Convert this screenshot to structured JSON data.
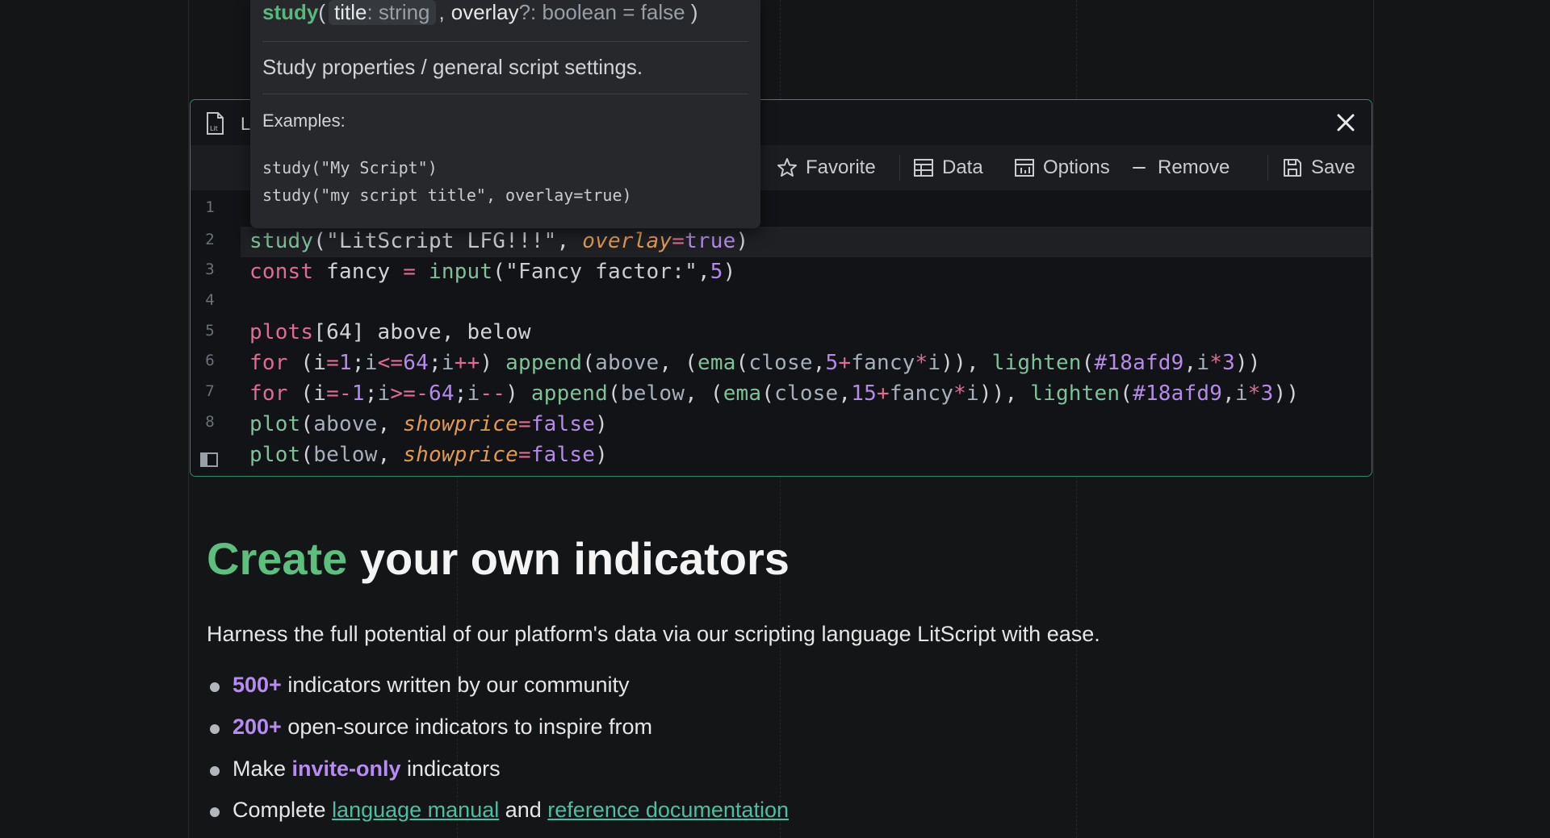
{
  "editor": {
    "title": "L",
    "toolbar": {
      "favorite": "Favorite",
      "data": "Data",
      "options": "Options",
      "remove": "Remove",
      "save": "Save"
    },
    "line_numbers": [
      "1",
      "2",
      "3",
      "4",
      "5",
      "6",
      "7",
      "8"
    ]
  },
  "tooltip": {
    "fn": "study",
    "param1_name": "title",
    "param1_type": ": string",
    "param2_name": "overlay",
    "param2_type": "?: boolean = false",
    "description": "Study properties / general script settings.",
    "examples_label": "Examples:",
    "example1": "study(\"My Script\")",
    "example2": "study(\"my script title\", overlay=true)"
  },
  "content": {
    "heading_accent": "Create",
    "heading_rest": " your own indicators",
    "paragraph": "Harness the full potential of our platform's data via our scripting language LitScript with ease.",
    "bullet1_hl": "500+",
    "bullet1_rest": " indicators written by our community",
    "bullet2_hl": "200+",
    "bullet2_rest": " open-source indicators to inspire from",
    "bullet3_pre": "Make ",
    "bullet3_hl": "invite-only",
    "bullet3_post": " indicators",
    "bullet4_pre": "Complete ",
    "bullet4_link1": "language manual",
    "bullet4_mid": " and ",
    "bullet4_link2": "reference documentation"
  }
}
